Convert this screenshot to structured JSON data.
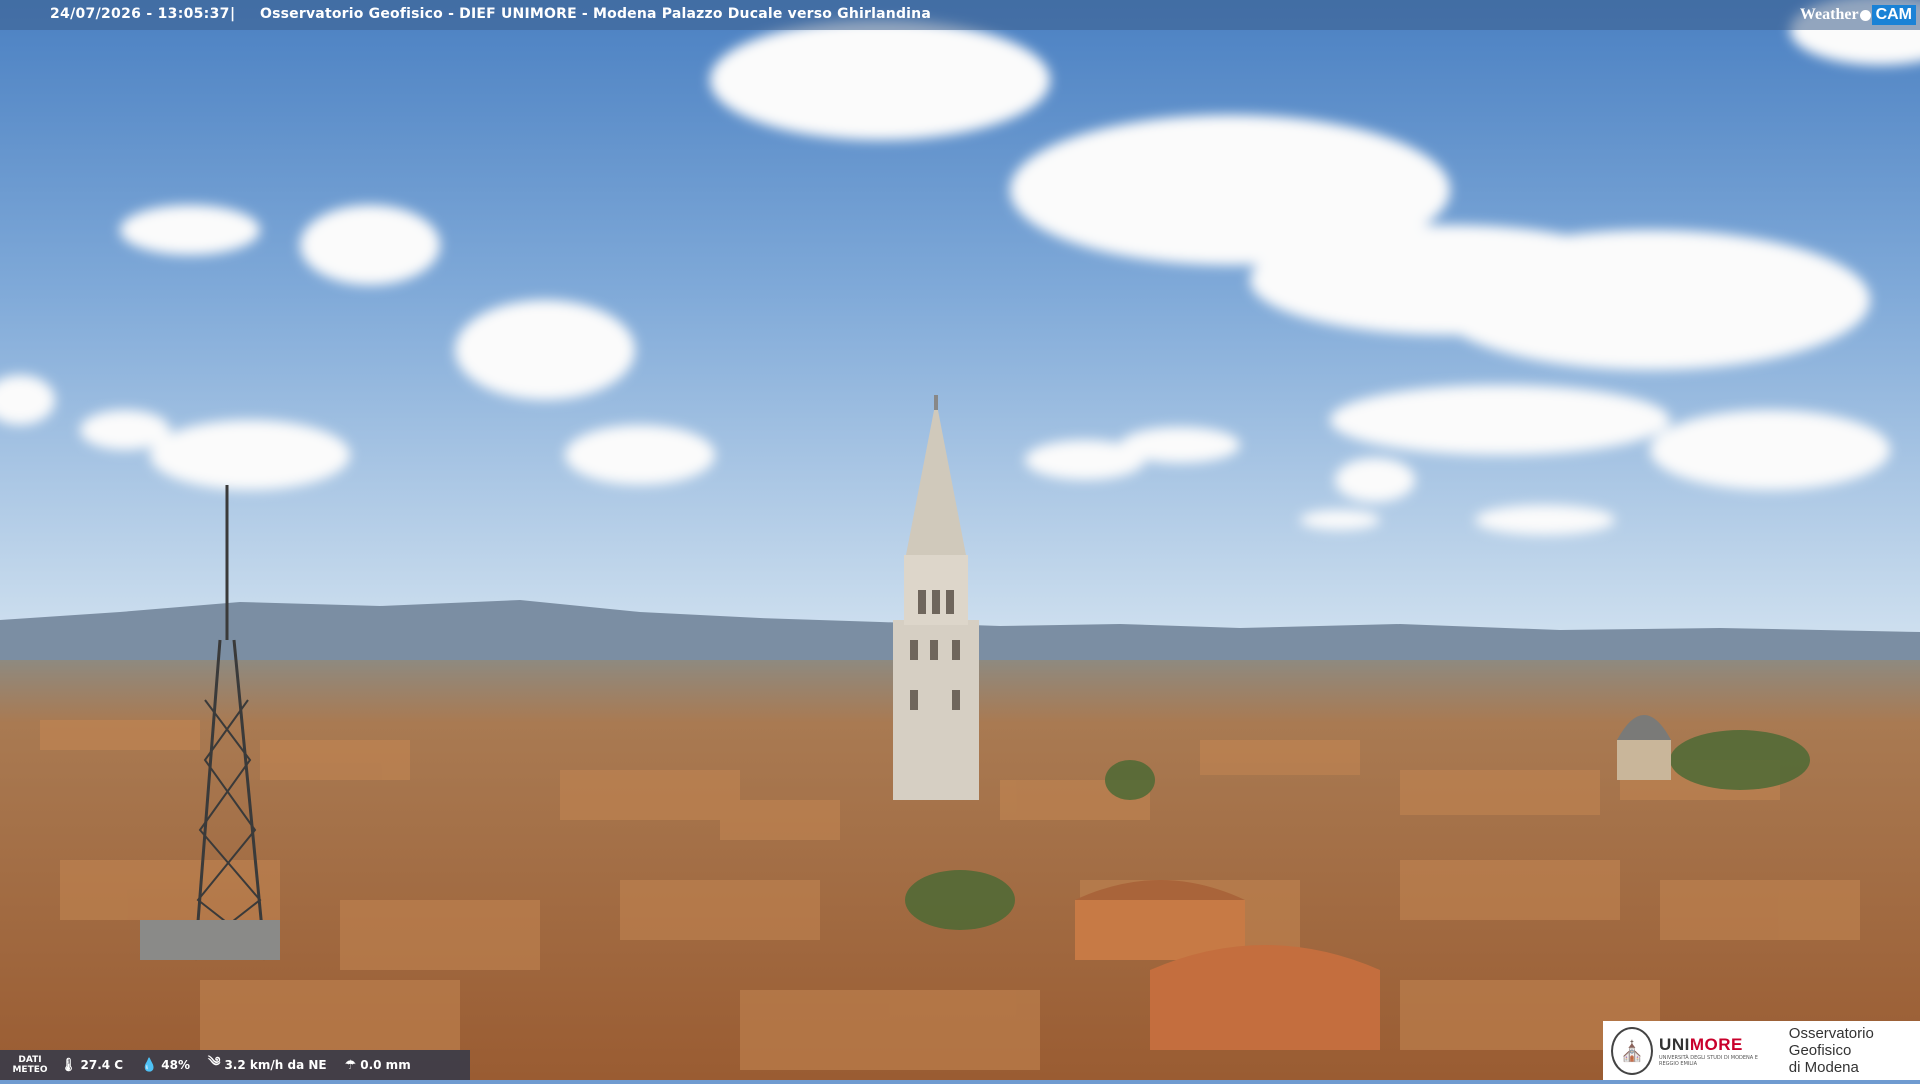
{
  "overlay": {
    "timestamp": "24/07/2026 - 13:05:37",
    "separator": "|",
    "title": "Osservatorio Geofisico - DIEF UNIMORE - Modena Palazzo Ducale verso Ghirlandina",
    "brand_weather": "Weather",
    "brand_cam": "CAM"
  },
  "meteo": {
    "label_line1": "DATI",
    "label_line2": "METEO",
    "temperature": "27.4 C",
    "humidity": "48%",
    "wind": "3.2 km/h da NE",
    "rain": "0.0 mm",
    "temperature_icon": "thermometer-icon",
    "humidity_icon": "drop-icon",
    "wind_icon": "wind-icon",
    "rain_icon": "rain-icon"
  },
  "logo": {
    "name_prefix": "UNI",
    "name_suffix": "MORE",
    "subtitle": "UNIVERSITÀ DEGLI STUDI DI MODENA E REGGIO EMILIA",
    "observatory_line1": "Osservatorio Geofisico",
    "observatory_line2": "di Modena"
  },
  "colors": {
    "sky_top": "#4f86c6",
    "sky_bottom": "#c9dcef",
    "roof": "#b5733f",
    "tower": "#d9d2c5",
    "cam_accent": "#1a82d6",
    "unimore_red": "#c9002b"
  }
}
